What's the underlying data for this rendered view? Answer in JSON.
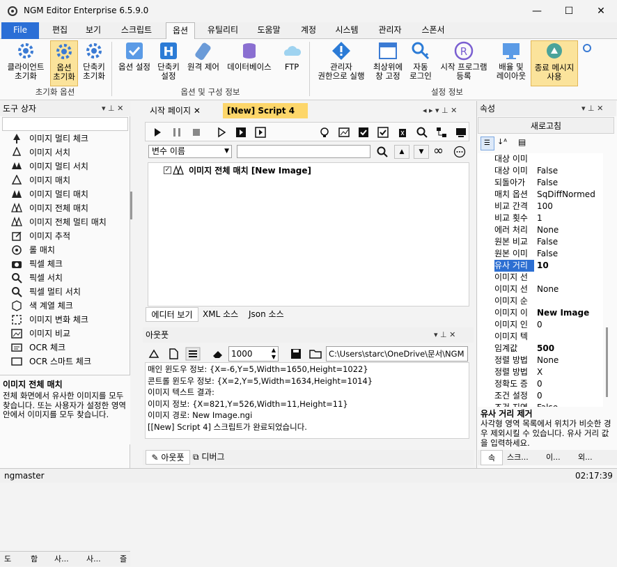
{
  "window": {
    "title": "NGM Editor   Enterprise 6.5.9.0",
    "min": "—",
    "max": "☐",
    "close": "✕"
  },
  "menu": [
    "File",
    "편집",
    "보기",
    "스크립트",
    "옵션",
    "유틸리티",
    "도움말",
    "계정",
    "시스템",
    "관리자",
    "스폰서"
  ],
  "ribbon": {
    "buttons": [
      {
        "l1": "클라이언트",
        "l2": "초기화"
      },
      {
        "l1": "옵션",
        "l2": "초기화"
      },
      {
        "l1": "단축키",
        "l2": "초기화"
      },
      {
        "l1": "옵션 설정",
        "l2": ""
      },
      {
        "l1": "단축키",
        "l2": "설정"
      },
      {
        "l1": "원격 제어",
        "l2": ""
      },
      {
        "l1": "데이터베이스",
        "l2": ""
      },
      {
        "l1": "FTP",
        "l2": ""
      },
      {
        "l1": "관리자",
        "l2": "권한으로 실행"
      },
      {
        "l1": "최상위에",
        "l2": "창 고정"
      },
      {
        "l1": "자동",
        "l2": "로그인"
      },
      {
        "l1": "시작 프로그램",
        "l2": "등록"
      },
      {
        "l1": "배율 및",
        "l2": "레이아웃"
      },
      {
        "l1": "종료 메시지",
        "l2": "사용"
      }
    ],
    "groups": [
      "초기화 옵션",
      "옵션 및 구성 정보",
      "설정 정보"
    ]
  },
  "toolbox": {
    "title": "도구 상자",
    "items": [
      "이미지 멀티 체크",
      "이미지 서치",
      "이미지 멀티 서치",
      "이미지 매치",
      "이미지 멀티 매치",
      "이미지 전체 매치",
      "이미지 전체 멀티 매치",
      "이미지 추적",
      "롤 매치",
      "픽셀 체크",
      "픽셀 서치",
      "픽셀 멀티 서치",
      "색 계열 체크",
      "이미지 변화 체크",
      "이미지 비교",
      "OCR 체크",
      "OCR 스마트 체크"
    ],
    "desc_title": "이미지 전체 매치",
    "desc_text": "전체 화면에서 유사한 이미지를 모두 찾습니다. 또는 사용자가 설정한 영역 안에서 이미지를 모두 찾습니다.",
    "tabs": [
      "도",
      "함",
      "사...",
      "사...",
      "즐"
    ]
  },
  "editor": {
    "tabs": [
      "시작 페이지",
      "[New] Script 4"
    ],
    "variable_placeholder": "변수 이름",
    "node": "이미지 전체 매치 [New Image]",
    "bottom_tabs": [
      "에디터 보기",
      "XML 소스",
      "Json 소스"
    ]
  },
  "output": {
    "title": "아웃풋",
    "count": "1000",
    "path": "C:\\Users\\starc\\OneDrive\\문서\\NGM",
    "lines": [
      "매인 윈도우 정보: {X=-6,Y=5,Width=1650,Height=1022}",
      "콘트롤 윈도우 정보: {X=2,Y=5,Width=1634,Height=1014}",
      "이미지 텍스트 결과:",
      "이미지 정보: {X=821,Y=526,Width=11,Height=11}",
      "이미지 경로: New Image.ngi",
      "[[New] Script 4] 스크립트가 완료되었습니다."
    ],
    "tabs": [
      "아웃풋",
      "디버그"
    ]
  },
  "properties": {
    "title": "속성",
    "refresh": "새로고침",
    "rows": [
      {
        "name": "대상 이미",
        "value": ""
      },
      {
        "name": "대상 이미",
        "value": "False"
      },
      {
        "name": "되돌아가",
        "value": "False"
      },
      {
        "name": "매치 옵션",
        "value": "SqDiffNormed"
      },
      {
        "name": "비교 간격",
        "value": "100"
      },
      {
        "name": "비교 횟수",
        "value": "1"
      },
      {
        "name": "에러 처리",
        "value": "None"
      },
      {
        "name": "원본 비교",
        "value": "False"
      },
      {
        "name": "원본 이미",
        "value": "False"
      },
      {
        "name": "유사 거리",
        "value": "10"
      },
      {
        "name": "이미지 선",
        "value": ""
      },
      {
        "name": "이미지 선",
        "value": "None"
      },
      {
        "name": "이미지 순",
        "value": ""
      },
      {
        "name": "이미지 이",
        "value": "New Image"
      },
      {
        "name": "이미지 인",
        "value": "0"
      },
      {
        "name": "이미지 텍",
        "value": ""
      },
      {
        "name": "임계값",
        "value": "500"
      },
      {
        "name": "정렬 방법",
        "value": "None"
      },
      {
        "name": "정렬 방법",
        "value": "X"
      },
      {
        "name": "정확도 증",
        "value": "0"
      },
      {
        "name": "조건 설정",
        "value": "0"
      },
      {
        "name": "조건 지연",
        "value": "False"
      }
    ],
    "desc_title": "유사 거리 제거",
    "desc_text": "사각형 영역 목록에서 위치가 비슷한 경우 제외시킬 수 있습니다. 유사 거리 값을 입력하세요.",
    "tabs": [
      "속",
      "스크...",
      "이...",
      "외..."
    ]
  },
  "status": {
    "user": "ngmaster",
    "time": "02:17:39"
  }
}
